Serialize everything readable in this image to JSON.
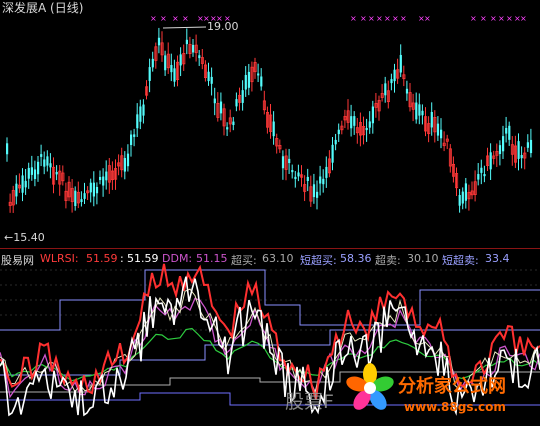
{
  "chart": {
    "title": "深发展A (日线)",
    "high_label": "19.00",
    "low_label": "←15.40"
  },
  "indicator": {
    "brand": "股易网",
    "items": [
      {
        "label": "WLRSI:",
        "value": "51.59",
        "color": "#ff3b3b"
      },
      {
        "label": ":",
        "value": "51.59",
        "color": "#ffffff"
      },
      {
        "label": "DDM:",
        "value": "51.15",
        "color": "#cc55cc"
      },
      {
        "label": "超买:",
        "value": "63.10",
        "color": "#aaaaaa"
      },
      {
        "label": "短超买:",
        "value": "58.36",
        "color": "#9aa0ff"
      },
      {
        "label": "超卖:",
        "value": "30.10",
        "color": "#aaaaaa"
      },
      {
        "label": "短超卖:",
        "value": "33.4",
        "color": "#9aa0ff"
      }
    ]
  },
  "watermark": "股票F",
  "logo": {
    "text": "分析家公式网",
    "url": "www.88gs.com"
  },
  "colors": {
    "up": "#ff3838",
    "down": "#54fcfc",
    "marker": "#ff44ff"
  }
}
